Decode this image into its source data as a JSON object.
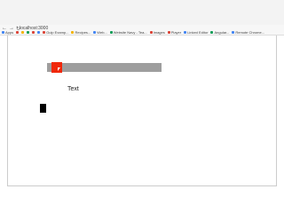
{
  "browser": {
    "url": "localhost:3000",
    "bookmarks": [
      {
        "label": "Apps",
        "color": "#4285f4"
      },
      {
        "label": "",
        "color": "#db4437"
      },
      {
        "label": "",
        "color": "#f4b400"
      },
      {
        "label": "",
        "color": "#0f9d58"
      },
      {
        "label": "",
        "color": "#db4437"
      },
      {
        "label": "",
        "color": "#4285f4"
      },
      {
        "label": "Gulp Examp...",
        "color": "#db4437"
      },
      {
        "label": "Recipes...",
        "color": "#f4b400"
      },
      {
        "label": "Web...",
        "color": "#4285f4"
      },
      {
        "label": "Website Navy - Tea...",
        "color": "#0f9d58"
      },
      {
        "label": "Images",
        "color": "#db4437"
      },
      {
        "label": "Player",
        "color": "#db4437"
      },
      {
        "label": "Linked Editor",
        "color": "#4285f4"
      },
      {
        "label": "Angular...",
        "color": "#0f9d58"
      },
      {
        "label": "Remote Chrome...",
        "color": "#4285f4"
      }
    ]
  },
  "page": {
    "text_label": "Text"
  },
  "slider": {
    "value_fraction": 0.07,
    "track_color": "#9e9e9e",
    "handle_color": "#f0280a"
  },
  "colors": {
    "background": "#ffffff",
    "box": "#000000"
  }
}
